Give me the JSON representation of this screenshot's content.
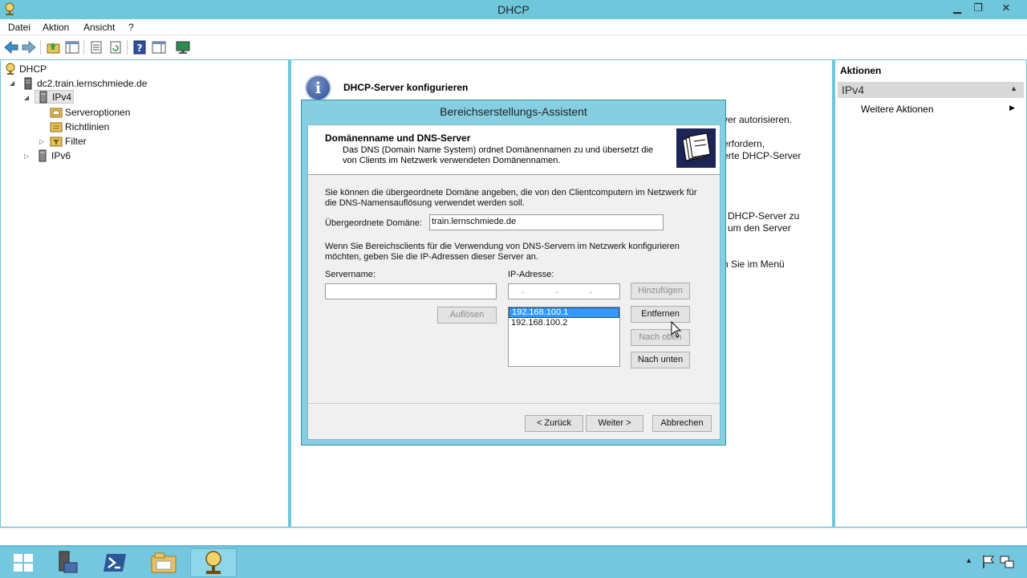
{
  "window": {
    "title": "DHCP"
  },
  "menu": [
    "Datei",
    "Aktion",
    "Ansicht",
    "?"
  ],
  "tree": {
    "root": "DHCP",
    "server": "dc2.train.lernschmiede.de",
    "ipv4": "IPv4",
    "serveroptionen": "Serveroptionen",
    "richtlinien": "Richtlinien",
    "filter": "Filter",
    "ipv6": "IPv6"
  },
  "center": {
    "title": "DHCP-Server konfigurieren",
    "lines": [
      "ver autorisieren.",
      "erfordern,",
      "erte DHCP-Server",
      "DHCP-Server zu",
      "um den Server",
      "n Sie im Menü"
    ]
  },
  "actions": {
    "header": "Aktionen",
    "section": "IPv4",
    "link": "Weitere Aktionen"
  },
  "wizard": {
    "title": "Bereichserstellungs-Assistent",
    "header_title": "Domänenname und DNS-Server",
    "header_desc": "Das DNS (Domain Name System) ordnet Domänennamen zu und übersetzt die von Clients im Netzwerk verwendeten Domänennamen.",
    "intro": "Sie können die übergeordnete Domäne angeben, die von den Clientcomputern im Netzwerk für die DNS-Namensauflösung verwendet werden soll.",
    "parent_domain_label": "Übergeordnete Domäne:",
    "parent_domain_value": "train.lernschmiede.de",
    "dns_intro": "Wenn Sie Bereichsclients für die Verwendung von DNS-Servern im Netzwerk konfigurieren möchten, geben Sie die IP-Adressen dieser Server an.",
    "servername_label": "Servername:",
    "servername_value": "",
    "ip_label": "IP-Adresse:",
    "ip_value": ". . .",
    "ip_list": [
      "192.168.100.1",
      "192.168.100.2"
    ],
    "buttons": {
      "add": "Hinzufügen",
      "resolve": "Auflösen",
      "remove": "Entfernen",
      "up": "Nach oben",
      "down": "Nach unten",
      "back": "< Zurück",
      "next": "Weiter >",
      "cancel": "Abbrechen"
    }
  }
}
